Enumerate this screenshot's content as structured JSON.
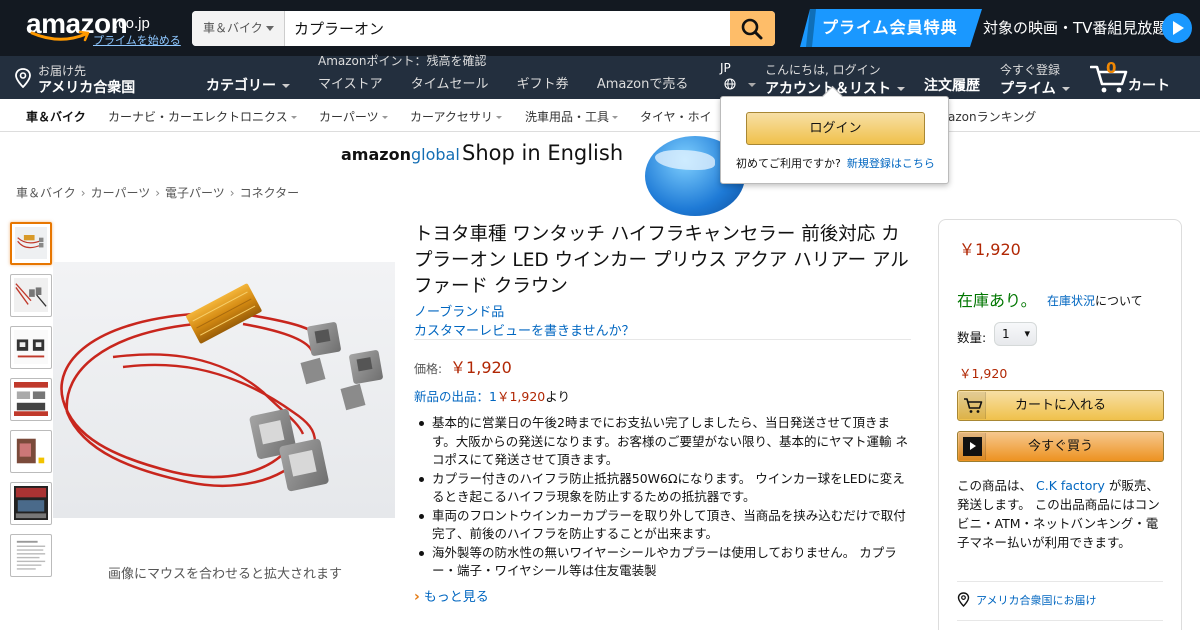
{
  "header": {
    "logo_text": "amazon",
    "logo_tld": ".co.jp",
    "logo_prime_link": "プライムを始める",
    "search_category": "車＆バイク",
    "search_value": "カプラーオン",
    "prime_badge": "プライム会員特典",
    "prime_text": "対象の映画・TV番組見放題"
  },
  "nav": {
    "deliver_line1": "お届け先",
    "deliver_line2": "アメリカ合衆国",
    "categories": "カテゴリー",
    "points": "Amazonポイント：残高を確認",
    "links": [
      "マイストア",
      "タイムセール",
      "ギフト券",
      "Amazonで売る"
    ],
    "lang": "JP",
    "account_line1": "こんにちは, ログイン",
    "account_line2": "アカウント＆リスト",
    "orders": "注文履歴",
    "prime_line1": "今すぐ登録",
    "prime_line2": "プライム",
    "cart_count": "0",
    "cart_label": "カート"
  },
  "subnav": {
    "items": [
      "車＆バイク",
      "カーナビ・カーエレクトロニクス",
      "カーパーツ",
      "カーアクセサリ",
      "洗車用品・工具",
      "タイヤ・ホイ",
      "azonランキング"
    ]
  },
  "banner": {
    "logo_amazon": "amazon",
    "logo_global": "global",
    "text": "Shop in English"
  },
  "breadcrumb": [
    "車＆バイク",
    "カーパーツ",
    "電子パーツ",
    "コネクター"
  ],
  "gallery": {
    "hint": "画像にマウスを合わせると拡大されます"
  },
  "product": {
    "title": "トヨタ車種 ワンタッチ ハイフラキャンセラー 前後対応 カプラーオン LED ウインカー プリウス アクア ハリアー アルファード クラウン",
    "brand": "ノーブランド品",
    "review_link": "カスタマーレビューを書きませんか？",
    "price_label": "価格:",
    "price": "￥1,920",
    "new_offers_prefix": "新品の出品：1",
    "new_offers_price": "￥1,920",
    "new_offers_suffix": "より",
    "bullets": [
      "基本的に営業日の午後2時までにお支払い完了しましたら、当日発送させて頂きます。大阪からの発送になります。お客様のご要望がない限り、基本的にヤマト運輸 ネコポスにて発送させて頂きます。",
      "カプラー付きのハイフラ防止抵抗器50W6Ωになります。 ウインカー球をLEDに変えるとき起こるハイフラ現象を防止するための抵抗器です。",
      "車両のフロントウインカーカプラーを取り外して頂き、当商品を挟み込むだけで取付完了、前後のハイフラを防止することが出来ます。",
      "海外製等の防水性の無いワイヤーシールやカプラーは使用しておりません。 カプラー・端子・ワイヤシール等は住友電装製"
    ],
    "more": "もっと見る"
  },
  "buybox": {
    "price": "￥1,920",
    "stock": "在庫あり。",
    "stock_link": "在庫状況",
    "stock_suffix": "について",
    "qty_label": "数量:",
    "qty_value": "1",
    "price_small": "￥1,920",
    "add_to_cart": "カートに入れる",
    "buy_now": "今すぐ買う",
    "seller_prefix": "この商品は、",
    "seller_name": "C.K factory",
    "seller_suffix": "が販売、発送します。 この出品商品にはコンビニ・ATM・ネットバンキング・電子マネー払いが利用できます。",
    "ship_to": "アメリカ合衆国にお届け"
  },
  "flyout": {
    "login_button": "ログイン",
    "new_prompt": "初めてご利用ですか?",
    "register_link": "新規登録はこちら"
  },
  "colors": {
    "header_bg": "#131921",
    "nav_bg": "#232f3e",
    "search_button": "#febd69",
    "link": "#0066c0",
    "price": "#b12704",
    "in_stock": "#007600",
    "prime_blue": "#1a98ff"
  }
}
